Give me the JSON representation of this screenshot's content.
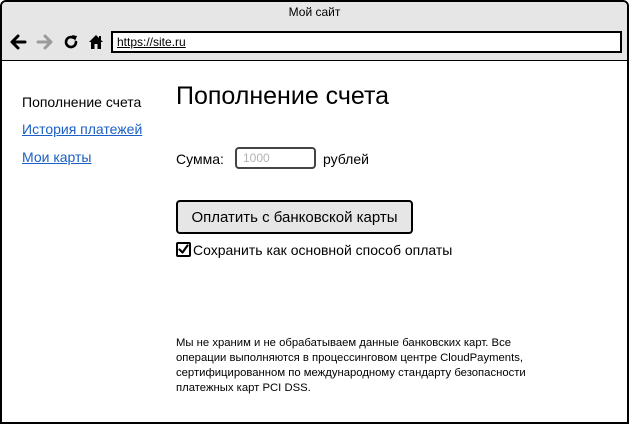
{
  "window": {
    "title": "Мой сайт"
  },
  "browser": {
    "url": "https://site.ru",
    "icons": [
      "back-arrow-icon",
      "forward-arrow-icon",
      "reload-icon",
      "home-icon"
    ]
  },
  "sidebar": {
    "current": "Пополнение счета",
    "links": [
      "История платежей",
      "Мои карты"
    ]
  },
  "main": {
    "title": "Пополнение счета",
    "amount": {
      "label": "Сумма:",
      "value": "",
      "placeholder": "1000",
      "unit": "рублей"
    },
    "pay_button": "Оплатить с банковской карты",
    "save_checkbox": {
      "checked": true,
      "label": "Сохранить как основной способ оплаты"
    },
    "disclaimer": [
      "Мы не храним и не обрабатываем данные банковских карт. Все",
      "операции выполняются в процессинговом центре CloudPayments,",
      "сертифицированном по международному стандарту безопасности",
      "платежных карт PCI DSS."
    ]
  },
  "colors": {
    "chrome": "#e6e6e6",
    "link": "#1a5fc7",
    "forward_disabled": "#9a9a9a"
  }
}
